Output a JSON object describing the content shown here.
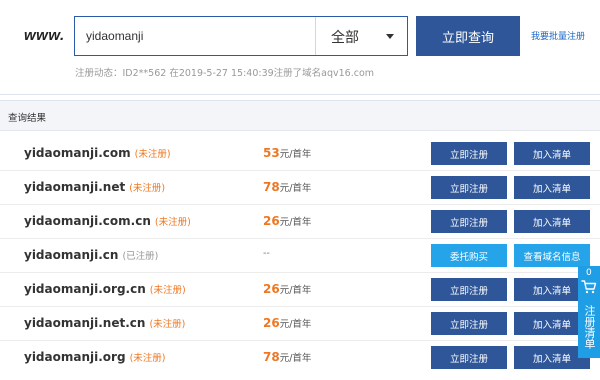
{
  "search": {
    "prefix": "www.",
    "value": "yidaomanji",
    "select_value": "全部",
    "button_label": "立即查询",
    "batch_link": "我要批量注册",
    "reg_dynamic": "注册动态：ID2**562 在2019-5-27 15:40:39注册了域名aqv16.com"
  },
  "results": {
    "title": "查询结果",
    "rows": [
      {
        "domain": "yidaomanji.com",
        "status": "(未注册)",
        "price": "53",
        "unit": "元/首年",
        "btn1": "立即注册",
        "btn2": "加入清单"
      },
      {
        "domain": "yidaomanji.net",
        "status": "(未注册)",
        "price": "78",
        "unit": "元/首年",
        "btn1": "立即注册",
        "btn2": "加入清单"
      },
      {
        "domain": "yidaomanji.com.cn",
        "status": "(未注册)",
        "price": "26",
        "unit": "元/首年",
        "btn1": "立即注册",
        "btn2": "加入清单"
      },
      {
        "domain": "yidaomanji.cn",
        "status": "(已注册)",
        "price": "--",
        "unit": "",
        "btn1": "委托购买",
        "btn2": "查看域名信息"
      },
      {
        "domain": "yidaomanji.org.cn",
        "status": "(未注册)",
        "price": "26",
        "unit": "元/首年",
        "btn1": "立即注册",
        "btn2": "加入清单"
      },
      {
        "domain": "yidaomanji.net.cn",
        "status": "(未注册)",
        "price": "26",
        "unit": "元/首年",
        "btn1": "立即注册",
        "btn2": "加入清单"
      },
      {
        "domain": "yidaomanji.org",
        "status": "(未注册)",
        "price": "78",
        "unit": "元/首年",
        "btn1": "立即注册",
        "btn2": "加入清单"
      }
    ]
  },
  "cart": {
    "count": "0",
    "label": "注册清单",
    "icon": "cart-icon"
  },
  "colors": {
    "primary": "#2e5699",
    "accent": "#26a4ea",
    "price": "#ee7722"
  }
}
